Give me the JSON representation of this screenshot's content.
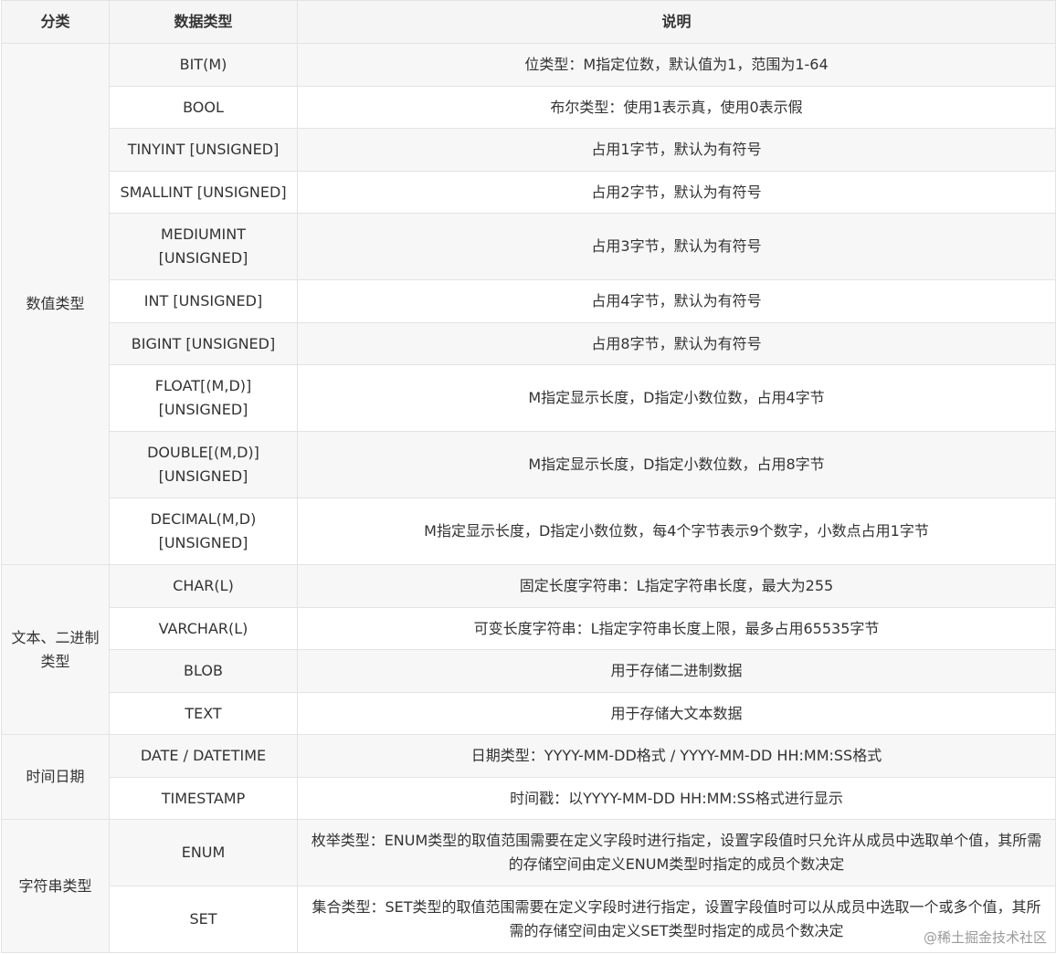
{
  "headers": [
    "分类",
    "数据类型",
    "说明"
  ],
  "groups": [
    {
      "category": "数值类型",
      "rows": [
        {
          "type": "BIT(M)",
          "desc": "位类型：M指定位数，默认值为1，范围为1-64"
        },
        {
          "type": "BOOL",
          "desc": "布尔类型：使用1表示真，使用0表示假"
        },
        {
          "type": "TINYINT [UNSIGNED]",
          "desc": "占用1字节，默认为有符号"
        },
        {
          "type": "SMALLINT [UNSIGNED]",
          "desc": "占用2字节，默认为有符号"
        },
        {
          "type": "MEDIUMINT [UNSIGNED]",
          "desc": "占用3字节，默认为有符号"
        },
        {
          "type": "INT [UNSIGNED]",
          "desc": "占用4字节，默认为有符号"
        },
        {
          "type": "BIGINT [UNSIGNED]",
          "desc": "占用8字节，默认为有符号"
        },
        {
          "type": "FLOAT[(M,D)] [UNSIGNED]",
          "desc": "M指定显示长度，D指定小数位数，占用4字节"
        },
        {
          "type": "DOUBLE[(M,D)] [UNSIGNED]",
          "desc": "M指定显示长度，D指定小数位数，占用8字节"
        },
        {
          "type": "DECIMAL(M,D) [UNSIGNED]",
          "desc": "M指定显示长度，D指定小数位数，每4个字节表示9个数字，小数点占用1字节"
        }
      ]
    },
    {
      "category": "文本、二进制类型",
      "rows": [
        {
          "type": "CHAR(L)",
          "desc": "固定长度字符串：L指定字符串长度，最大为255"
        },
        {
          "type": "VARCHAR(L)",
          "desc": "可变长度字符串：L指定字符串长度上限，最多占用65535字节"
        },
        {
          "type": "BLOB",
          "desc": "用于存储二进制数据"
        },
        {
          "type": "TEXT",
          "desc": "用于存储大文本数据"
        }
      ]
    },
    {
      "category": "时间日期",
      "rows": [
        {
          "type": "DATE / DATETIME",
          "desc": "日期类型：YYYY-MM-DD格式 / YYYY-MM-DD HH:MM:SS格式"
        },
        {
          "type": "TIMESTAMP",
          "desc": "时间戳：以YYYY-MM-DD HH:MM:SS格式进行显示"
        }
      ]
    },
    {
      "category": "字符串类型",
      "rows": [
        {
          "type": "ENUM",
          "desc": "枚举类型：ENUM类型的取值范围需要在定义字段时进行指定，设置字段值时只允许从成员中选取单个值，其所需的存储空间由定义ENUM类型时指定的成员个数决定"
        },
        {
          "type": "SET",
          "desc": "集合类型：SET类型的取值范围需要在定义字段时进行指定，设置字段值时可以从成员中选取一个或多个值，其所需的存储空间由定义SET类型时指定的成员个数决定"
        }
      ]
    }
  ],
  "watermark": "@稀土掘金技术社区"
}
